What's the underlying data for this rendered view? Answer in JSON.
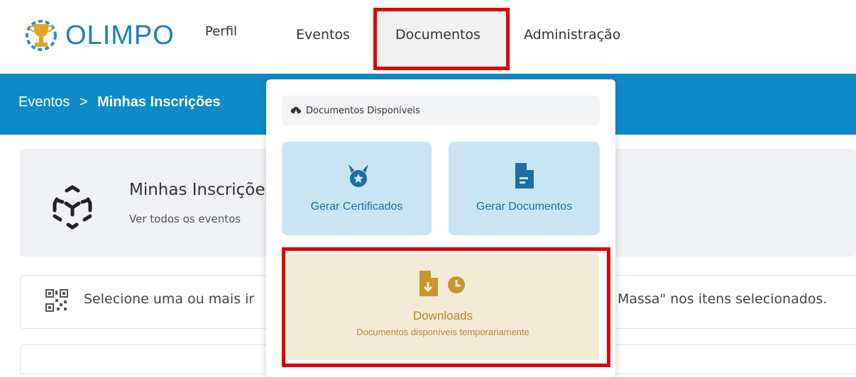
{
  "nav": {
    "logo_text": "OLIMPO",
    "items": [
      "Perfil",
      "Eventos",
      "Documentos",
      "Administração"
    ]
  },
  "breadcrumb": {
    "parent": "Eventos",
    "separator": ">",
    "current": "Minhas Inscrições"
  },
  "card": {
    "title": "Minhas Inscrições",
    "subtitle": "Ver todos os eventos"
  },
  "info": {
    "text_left": "Selecione uma ou mais ir",
    "text_right": "Massa\" nos itens selecionados."
  },
  "dropdown": {
    "header": "Documentos Disponíveis",
    "tiles": [
      {
        "label": "Gerar Certificados",
        "icon": "medal-icon"
      },
      {
        "label": "Gerar Documentos",
        "icon": "document-icon"
      }
    ],
    "downloads": {
      "title": "Downloads",
      "subtitle": "Documentos disponíveis temporariamente",
      "icon": "file-download-clock-icon"
    }
  },
  "colors": {
    "brand_blue": "#0d8ac8",
    "tile_blue": "#c9e5f3",
    "tile_text_blue": "#1d6ea3",
    "download_bg": "#f3ead8",
    "download_text": "#b8862c",
    "highlight_red": "#e00000"
  }
}
